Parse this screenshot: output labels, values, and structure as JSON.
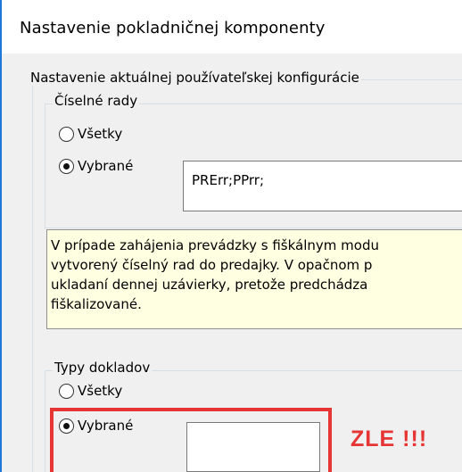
{
  "window": {
    "title": "Nastavenie pokladničnej komponenty"
  },
  "config_group": {
    "label": "Nastavenie aktuálnej používateľskej konfigurácie"
  },
  "number_series": {
    "label": "Číselné rady",
    "option_all": "Všetky",
    "option_selected": "Vybrané",
    "selected_value": "PRErr;PPrr;"
  },
  "info": {
    "lines": [
      "V prípade zahájenia prevádzky s fiškálnym modu",
      "vytvorený číselný rad do predajky. V opačnom p",
      "ukladaní dennej uzávierky, pretože predchádza",
      "fiškalizované."
    ]
  },
  "document_types": {
    "label": "Typy dokladov",
    "option_all": "Všetky",
    "option_selected": "Vybrané",
    "selected_value": ""
  },
  "annotation": {
    "text": "ZLE !!!",
    "color": "#e53535"
  }
}
